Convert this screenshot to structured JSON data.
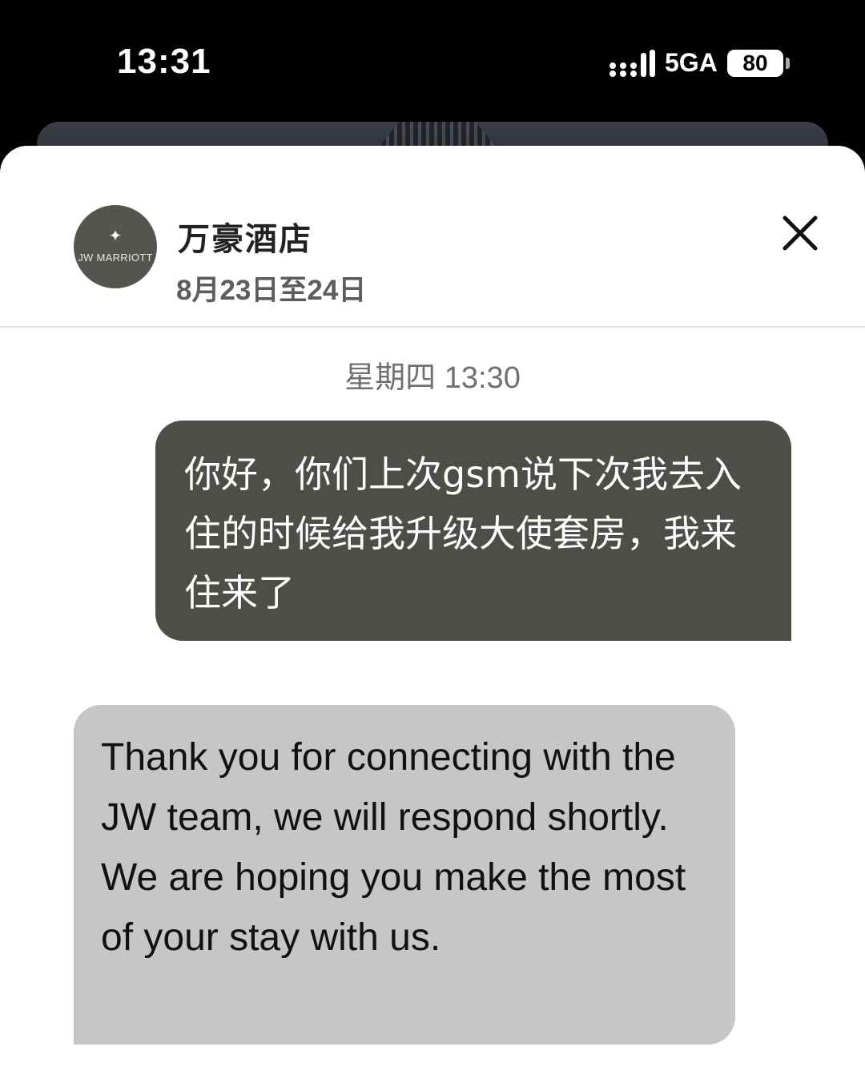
{
  "status_bar": {
    "time": "13:31",
    "network": "5GA",
    "battery_level": "80"
  },
  "chat_header": {
    "avatar_brand": "JW MARRIOTT",
    "hotel_name": "万豪酒店",
    "stay_dates": "8月23日至24日"
  },
  "conversation": {
    "timestamp": "星期四 13:30",
    "messages": [
      {
        "sender": "guest",
        "text": "你好，你们上次gsm说下次我去入住的时候给我升级大使套房，我来住来了"
      },
      {
        "sender": "hotel",
        "text": "Thank you for connecting with the JW team, we will respond shortly.  We are hoping you make the most of your stay with us."
      }
    ]
  },
  "colors": {
    "sent_bubble": "#4c4e49",
    "received_bubble": "#c6c6c6",
    "avatar_bg": "#54554f"
  },
  "icons": [
    "signal-icon",
    "battery-icon",
    "close-icon",
    "jw-marriott-logo-icon"
  ]
}
